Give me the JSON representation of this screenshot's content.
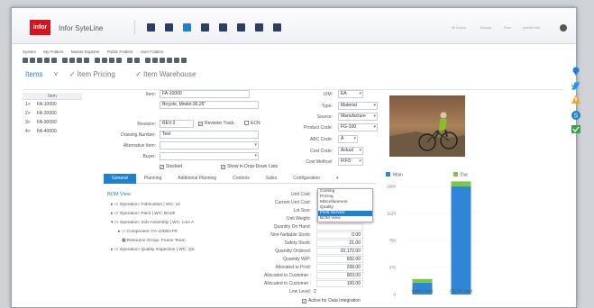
{
  "header": {
    "logo_text": "infor",
    "app_name": "Infor SyteLine",
    "top_links": [
      "Mi Activo",
      "Buscar",
      "Plan",
      "psmith info"
    ]
  },
  "menu": [
    "System",
    "My Folders",
    "Master Explorer",
    "Public Folders",
    "User Folders"
  ],
  "form_tabs": [
    "Items",
    "Item Pricing",
    "Item Warehouse"
  ],
  "list": {
    "header": "Item",
    "rows": [
      {
        "n": "1>",
        "item": "FA-10000"
      },
      {
        "n": "2>",
        "item": "FA-20000"
      },
      {
        "n": "3>",
        "item": "FA-30000"
      },
      {
        "n": "4>",
        "item": "FA-40000"
      }
    ]
  },
  "form": {
    "item_label": "Item:",
    "item_value": "FA-10000",
    "desc_value": "Bicycle, Model-30,26\"",
    "revision_label": "Revision:",
    "revision_value": "REV-2",
    "revision_track": "Revision Track",
    "ecn": "ECN",
    "drawing_label": "Drawing Number:",
    "drawing_value": "Test",
    "alt_item_label": "Alternative Item:",
    "buyer_label": "Buyer:",
    "stocked": "Stocked",
    "show_dd": "Show in Drop-Down Lists",
    "um_label": "U/M:",
    "um_value": "EA",
    "type_label": "Type:",
    "type_value": "Material",
    "source_label": "Source:",
    "source_value": "Manufacture",
    "product_label": "Product Code:",
    "product_value": "FG-100",
    "abc_label": "ABC Code:",
    "abc_value": "A",
    "cost_code_label": "Cost Code:",
    "cost_code_value": "Actual",
    "cost_method_label": "Cost Method:",
    "cost_method_value": "FIFO"
  },
  "subtabs": [
    "General",
    "Planning",
    "Additional Planning",
    "Controls",
    "Sales",
    "Configuration"
  ],
  "bom": {
    "title": "BOM View",
    "tree": [
      "Operation: Fabrication | WC: 12",
      "Operation: Paint | WC: Booth",
      "Operation: Sub-Assembly | WC: Line A",
      "Component:  FA-10000-FR",
      "Resource Group:  Frame Team",
      "Operation: Quality Inspection | WC: QC"
    ]
  },
  "quantities": [
    {
      "label": "Unit Cost:",
      "value": ""
    },
    {
      "label": "Current Unit Cost:",
      "value": ""
    },
    {
      "label": "Lot Size:",
      "value": ""
    },
    {
      "label": "Unit Weight:",
      "value": ""
    },
    {
      "label": "Quantity On Hand:",
      "value": ""
    },
    {
      "label": "Non-Nettable Stock:",
      "value": "0.00"
    },
    {
      "label": "Safety Stock:",
      "value": "21.00"
    },
    {
      "label": "Quantity Ordered:",
      "value": "20,172.00"
    },
    {
      "label": "Quantity WIP:",
      "value": "692.00"
    },
    {
      "label": "Allocated to Prod:",
      "value": "208.00"
    },
    {
      "label": "Allocated to Customer :",
      "value": "903.00"
    },
    {
      "label": "Allocated to Customer :",
      "value": "100.00"
    }
  ],
  "low_level": {
    "label": "Low Level:",
    "value": "2"
  },
  "active_integration": "Active for Data Integration",
  "popup": {
    "items": [
      "Costing",
      "Pricing",
      "Miscellaneous",
      "Quality",
      "Field Service",
      "BOM View"
    ],
    "selected": 4
  },
  "chart_data": {
    "type": "bar",
    "categories": [
      "Safety Stock",
      "Qty On Hand"
    ],
    "series": [
      {
        "name": "Main",
        "values": [
          165,
          1500
        ],
        "color": "#2f86d6"
      },
      {
        "name": "Dur",
        "values": [
          0,
          0
        ],
        "color": "#7ac943"
      }
    ],
    "stacked_top": [
      50,
      70
    ],
    "yticks": [
      "0",
      "375",
      "750",
      "1125",
      "1500"
    ],
    "ylim": [
      0,
      1500
    ],
    "colors": {
      "main": "#2f86d6",
      "top": "#7ac943"
    }
  },
  "colors": {
    "accent": "#1f7fd1",
    "brand": "#d6121c"
  }
}
